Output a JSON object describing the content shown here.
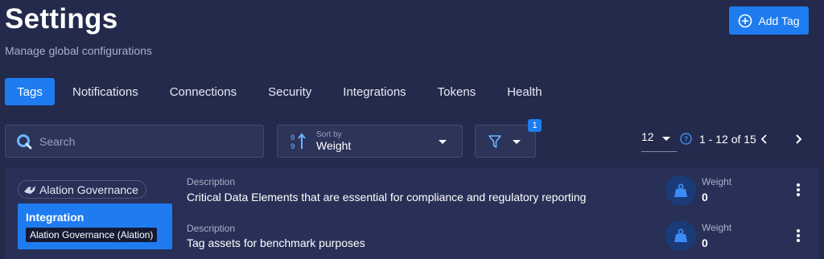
{
  "header": {
    "title": "Settings",
    "subtitle": "Manage global configurations",
    "add_tag_label": "Add Tag"
  },
  "tabs": [
    {
      "label": "Tags",
      "active": true
    },
    {
      "label": "Notifications",
      "active": false
    },
    {
      "label": "Connections",
      "active": false
    },
    {
      "label": "Security",
      "active": false
    },
    {
      "label": "Integrations",
      "active": false
    },
    {
      "label": "Tokens",
      "active": false
    },
    {
      "label": "Health",
      "active": false
    }
  ],
  "toolbar": {
    "search_placeholder": "Search",
    "sort_caption": "Sort by",
    "sort_value": "Weight",
    "filter_count": "1",
    "page_size": "12",
    "range_text": "1 - 12 of 15"
  },
  "tag_source": {
    "label": "Alation Governance"
  },
  "integration_popup": {
    "title": "Integration",
    "value": "Alation Governance (Alation)"
  },
  "rows": [
    {
      "description_caption": "Description",
      "description": "Critical Data Elements that are essential for compliance and regulatory reporting",
      "weight_caption": "Weight",
      "weight": "0"
    },
    {
      "description_caption": "Description",
      "description": "Tag assets for benchmark purposes",
      "weight_caption": "Weight",
      "weight": "0"
    }
  ],
  "colors": {
    "background": "#232a4b",
    "accent": "#1e7cf0",
    "row": "#283057"
  },
  "icons": [
    "plus-circle-icon",
    "search-icon",
    "sort-numeric-icon",
    "filter-icon",
    "help-icon",
    "chevron-left-icon",
    "chevron-right-icon",
    "weight-icon",
    "kebab-icon",
    "alation-logo-icon"
  ]
}
